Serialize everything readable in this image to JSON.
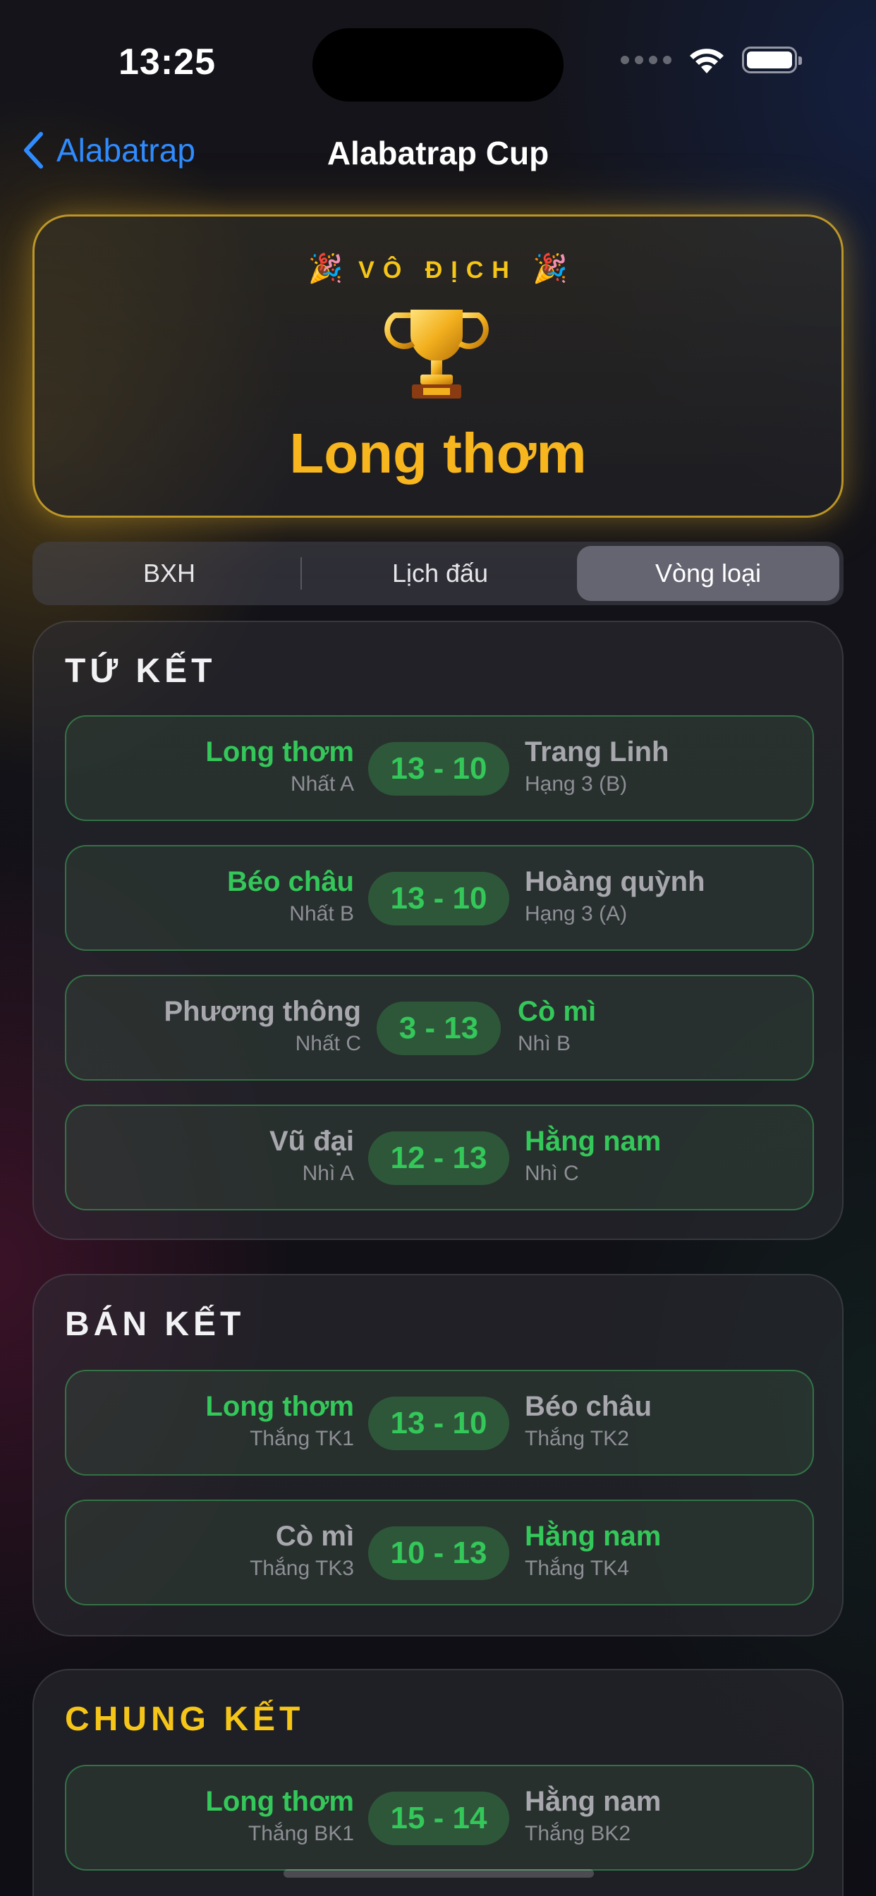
{
  "status_bar": {
    "time": "13:25"
  },
  "nav": {
    "back_label": "Alabatrap",
    "title": "Alabatrap Cup"
  },
  "champion": {
    "party_emoji": "🎉",
    "label": "VÔ ĐỊCH",
    "name": "Long thơm"
  },
  "tabs": [
    {
      "label": "BXH",
      "selected": false
    },
    {
      "label": "Lịch đấu",
      "selected": false
    },
    {
      "label": "Vòng loại",
      "selected": true
    }
  ],
  "rounds": [
    {
      "title": "TỨ KẾT",
      "matches": [
        {
          "home": "Long thơm",
          "home_seed": "Nhất A",
          "score": "13 - 10",
          "away": "Trang Linh",
          "away_seed": "Hạng 3 (B)",
          "winner": "home"
        },
        {
          "home": "Béo châu",
          "home_seed": "Nhất B",
          "score": "13 - 10",
          "away": "Hoàng quỳnh",
          "away_seed": "Hạng 3 (A)",
          "winner": "home"
        },
        {
          "home": "Phương thông",
          "home_seed": "Nhất C",
          "score": "3 - 13",
          "away": "Cò mì",
          "away_seed": "Nhì B",
          "winner": "away"
        },
        {
          "home": "Vũ đại",
          "home_seed": "Nhì A",
          "score": "12 - 13",
          "away": "Hằng nam",
          "away_seed": "Nhì C",
          "winner": "away"
        }
      ]
    },
    {
      "title": "BÁN KẾT",
      "matches": [
        {
          "home": "Long thơm",
          "home_seed": "Thắng TK1",
          "score": "13 - 10",
          "away": "Béo châu",
          "away_seed": "Thắng TK2",
          "winner": "home"
        },
        {
          "home": "Cò mì",
          "home_seed": "Thắng TK3",
          "score": "10 - 13",
          "away": "Hằng nam",
          "away_seed": "Thắng TK4",
          "winner": "away"
        }
      ]
    },
    {
      "title": "CHUNG KẾT",
      "matches": [
        {
          "home": "Long thơm",
          "home_seed": "Thắng BK1",
          "score": "15 - 14",
          "away": "Hằng nam",
          "away_seed": "Thắng BK2",
          "winner": "home"
        }
      ]
    }
  ],
  "colors": {
    "accent_blue": "#2f8cff",
    "gold": "#f5c518",
    "win_green": "#34c759"
  }
}
